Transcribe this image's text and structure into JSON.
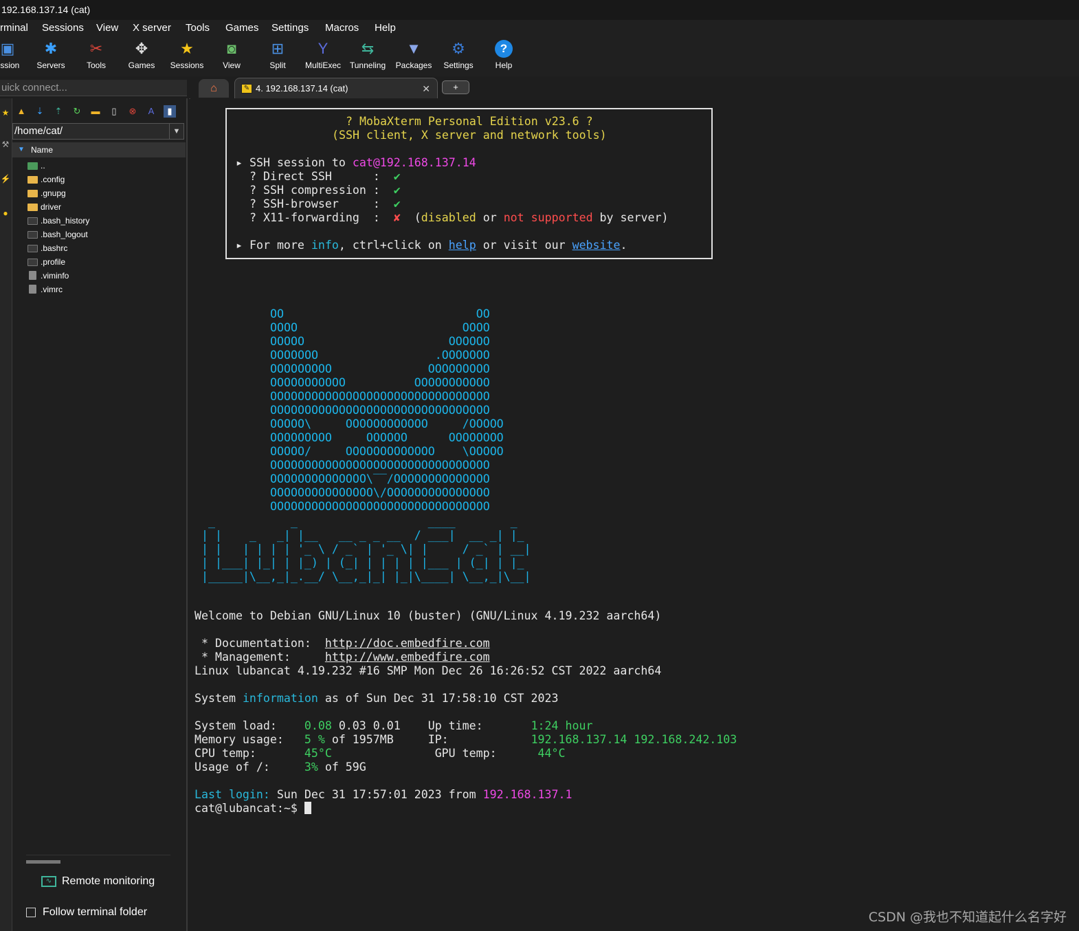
{
  "window": {
    "title": "192.168.137.14 (cat)"
  },
  "menu": [
    "rminal",
    "Sessions",
    "View",
    "X server",
    "Tools",
    "Games",
    "Settings",
    "Macros",
    "Help"
  ],
  "toolbar": [
    {
      "label": "ession",
      "icon": "session-icon"
    },
    {
      "label": "Servers",
      "icon": "servers-icon"
    },
    {
      "label": "Tools",
      "icon": "tools-icon"
    },
    {
      "label": "Games",
      "icon": "gamepad-icon"
    },
    {
      "label": "Sessions",
      "icon": "star-icon"
    },
    {
      "label": "View",
      "icon": "view-icon"
    },
    {
      "label": "Split",
      "icon": "split-icon"
    },
    {
      "label": "MultiExec",
      "icon": "multiexec-icon"
    },
    {
      "label": "Tunneling",
      "icon": "tunneling-icon"
    },
    {
      "label": "Packages",
      "icon": "packages-icon"
    },
    {
      "label": "Settings",
      "icon": "settings-icon"
    },
    {
      "label": "Help",
      "icon": "help-icon"
    }
  ],
  "quick_connect": {
    "placeholder": "uick connect..."
  },
  "tabs": {
    "active_label": "4. 192.168.137.14 (cat)",
    "new_tab": "+"
  },
  "sidebar": {
    "path": "/home/cat/",
    "column_header": "Name",
    "files": [
      {
        "name": "..",
        "type": "up"
      },
      {
        "name": ".config",
        "type": "folder"
      },
      {
        "name": ".gnupg",
        "type": "folder"
      },
      {
        "name": "driver",
        "type": "folder"
      },
      {
        "name": ".bash_history",
        "type": "term"
      },
      {
        "name": ".bash_logout",
        "type": "term"
      },
      {
        "name": ".bashrc",
        "type": "term"
      },
      {
        "name": ".profile",
        "type": "term"
      },
      {
        "name": ".viminfo",
        "type": "doc"
      },
      {
        "name": ".vimrc",
        "type": "doc"
      }
    ],
    "remote_monitoring": "Remote monitoring",
    "follow_terminal": "Follow terminal folder"
  },
  "terminal": {
    "banner": {
      "title": "? MobaXterm Personal Edition v23.6 ?",
      "subtitle": "(SSH client, X server and network tools)",
      "ssh_prefix": "▸ SSH session to ",
      "ssh_target": "cat@192.168.137.14",
      "direct_ssh": "? Direct SSH      :  ",
      "ssh_compression": "? SSH compression :  ",
      "ssh_browser": "? SSH-browser     :  ",
      "x11_forwarding": "? X11-forwarding  :  ",
      "check": "✔",
      "cross": "✘",
      "x11_note_1": "  (",
      "x11_disabled": "disabled",
      "x11_note_2": " or ",
      "x11_not_supported": "not supported",
      "x11_note_3": " by server)",
      "more_1": "▸ For more ",
      "more_info": "info",
      "more_2": ", ctrl+click on ",
      "more_help": "help",
      "more_3": " or visit our ",
      "more_website": "website",
      "more_4": "."
    },
    "ascii_cat": [
      "OO                            OO",
      "OOOO                        OOOO",
      "OOOOO                     OOOOOO",
      "OOOOOOO                 .OOOOOOO",
      "OOOOOOOOO              OOOOOOOOO",
      "OOOOOOOOOOO          OOOOOOOOOOO",
      "OOOOOOOOOOOOOOOOOOOOOOOOOOOOOOOO",
      "OOOOOOOOOOOOOOOOOOOOOOOOOOOOOOOO",
      "OOOOO\\     OOOOOOOOOOOO     /OOOOO",
      "OOOOOOOOO     OOOOOO      OOOOOOOO",
      "OOOOO/     OOOOOOOOOOOOO    \\OOOOO",
      "OOOOOOOOOOOOOOOOOOOOOOOOOOOOOOOO",
      "OOOOOOOOOOOOOO\\‾‾/OOOOOOOOOOOOOO",
      "OOOOOOOOOOOOOOO\\/OOOOOOOOOOOOOOO",
      "OOOOOOOOOOOOOOOOOOOOOOOOOOOOOOOO"
    ],
    "ascii_logo": [
      " _           _                   ____        _   ",
      "| |    _   _| |__   __ _ _ __  / ___|  __ _| |_ ",
      "| |   | | | | '_ \\ / _` | '_ \\| |     / _` | __|",
      "| |___| |_| | |_) | (_| | | | | |___ | (_| | |_ ",
      "|_____|\\__,_|_.__/ \\__,_|_| |_|\\____| \\__,_|\\__|"
    ],
    "welcome": "Welcome to Debian GNU/Linux 10 (buster) (GNU/Linux 4.19.232 aarch64)",
    "doc_label": " * Documentation:  ",
    "doc_url": "http://doc.embedfire.com",
    "mgmt_label": " * Management:     ",
    "mgmt_url": "http://www.embedfire.com",
    "uname": "Linux lubancat 4.19.232 #16 SMP Mon Dec 26 16:26:52 CST 2022 aarch64",
    "sysinfo_1": "System ",
    "sysinfo_word": "information",
    "sysinfo_2": " as of Sun Dec 31 17:58:10 CST 2023",
    "sysload_label": "System load:    ",
    "sysload_v1": "0.08",
    "sysload_rest": " 0.03 0.01    ",
    "uptime_label": "Up time:       ",
    "uptime_val": "1:24 hour",
    "mem_label": "Memory usage:   ",
    "mem_val": "5 %",
    "mem_rest": " of 1957MB     ",
    "ip_label": "IP:            ",
    "ip_val": "192.168.137.14 192.168.242.103",
    "cpu_label": "CPU temp:       ",
    "cpu_val": "45°C",
    "cpu_pad": "               ",
    "gpu_label": "GPU temp:      ",
    "gpu_val": "44°C",
    "usage_label": "Usage of /:     ",
    "usage_val": "3%",
    "usage_rest": " of 59G",
    "last_login_label": "Last login:",
    "last_login_text": " Sun Dec 31 17:57:01 2023 from ",
    "last_login_ip": "192.168.137.1",
    "prompt": "cat@lubancat:~$ "
  },
  "watermark": "CSDN @我也不知道起什么名字好"
}
